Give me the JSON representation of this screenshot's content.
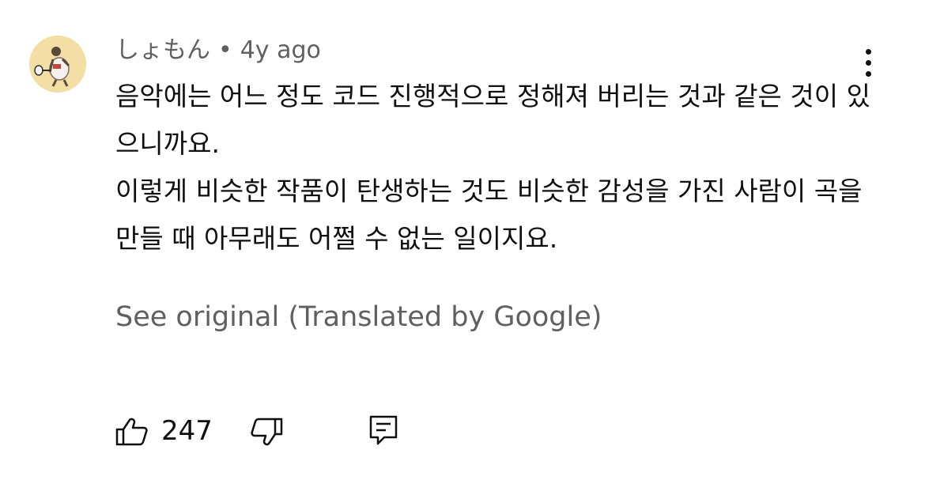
{
  "comment": {
    "author": "しょもん",
    "separator": "•",
    "timestamp": "4y ago",
    "text_lines": [
      "음악에는 어느 정도 코드 진행적으로 정해져 버리는 것과 같은 것이 있으니까요.",
      "이렇게 비슷한 작품이 탄생하는 것도 비슷한 감성을 가진 사람이 곡을 만들 때 아무래도 어쩔 수 없는 일이지요."
    ],
    "see_original": "See original (Translated by Google)",
    "like_count": "247",
    "avatar_bg": "#f3dfa6"
  },
  "icons": {
    "more": "more-vert-icon",
    "like": "thumbs-up-icon",
    "dislike": "thumbs-down-icon",
    "reply": "comment-reply-icon"
  }
}
